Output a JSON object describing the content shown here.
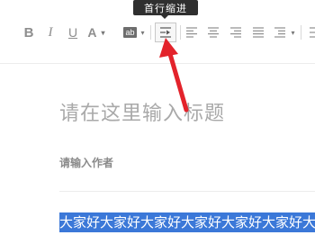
{
  "toolbar": {
    "bold_label": "B",
    "italic_label": "I",
    "underline_label": "U",
    "font_color_label": "A",
    "bg_color_label": "ab",
    "caret": "▾",
    "tooltip": "首行缩进"
  },
  "editor": {
    "title_placeholder": "请在这里输入标题",
    "author_placeholder": "请输入作者",
    "body_selected_text": "大家好大家好大家好大家好大家好大家好大家好"
  },
  "colors": {
    "selection": "#3b78d8",
    "arrow": "#e3232b",
    "tooltip_bg": "#2f2f2f"
  },
  "icons": [
    "bold-icon",
    "italic-icon",
    "underline-icon",
    "font-color-icon",
    "background-color-icon",
    "first-line-indent-icon",
    "align-left-icon",
    "align-center-icon",
    "align-right-icon",
    "justify-icon",
    "line-spacing-icon"
  ]
}
